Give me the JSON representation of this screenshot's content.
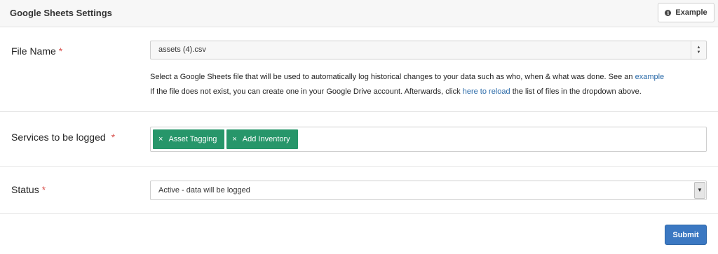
{
  "header": {
    "title": "Google Sheets Settings",
    "example_label": "Example",
    "example_icon": "info-icon"
  },
  "file_name": {
    "label": "File Name",
    "required_mark": "*",
    "value": "assets (4).csv",
    "help_line1_text": "Select a Google Sheets file that will be used to automatically log historical changes to your data such as who, when & what was done. See an",
    "help_line1_link": "example",
    "help_line2_prefix": "If the file does not exist, you can create one in your Google Drive account. Afterwards, click",
    "help_line2_link": "here to reload",
    "help_line2_suffix": "the list of files in the dropdown above."
  },
  "services": {
    "label": "Services to be logged",
    "required_mark": "*",
    "tags": [
      {
        "label": "Asset Tagging",
        "remove": "×"
      },
      {
        "label": "Add Inventory",
        "remove": "×"
      }
    ]
  },
  "status": {
    "label": "Status",
    "required_mark": "*",
    "value": "Active - data will be logged"
  },
  "actions": {
    "submit_label": "Submit"
  },
  "colors": {
    "tag_bg": "#27966a",
    "submit_bg": "#3b78c2",
    "link": "#2a6aa8",
    "required": "#d9534f"
  }
}
